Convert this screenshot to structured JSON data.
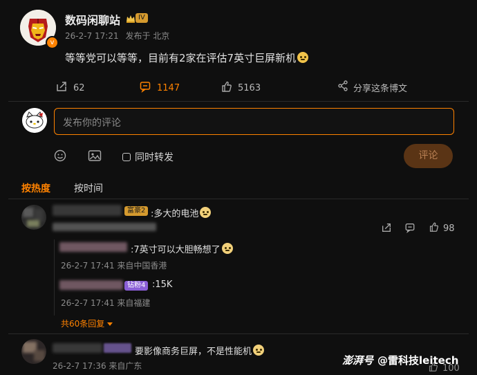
{
  "post": {
    "author_name": "数码闲聊站",
    "level_badge": "IV",
    "meta_time": "26-2-7 17:21",
    "meta_location": "发布于 北京",
    "content": "等等党可以等等，目前有2家在评估7英寸巨屏新机",
    "actions": {
      "repost_count": "62",
      "comment_count": "1147",
      "like_count": "5163",
      "share_label": "分享这条博文"
    }
  },
  "composer": {
    "placeholder": "发布你的评论",
    "also_repost_label": "同时转发",
    "submit_label": "评论"
  },
  "sort_tabs": {
    "hot": "按热度",
    "time": "按时间"
  },
  "comments": [
    {
      "badge": "富豪2",
      "text": ":多大的电池",
      "likes": "98",
      "replies": [
        {
          "text": ":7英寸可以大胆畅想了",
          "meta": "26-2-7 17:41 来自中国香港"
        },
        {
          "badge": "钻粉4",
          "text": ":15K",
          "meta": "26-2-7 17:41 来自福建"
        }
      ],
      "more_replies": "共60条回复"
    },
    {
      "text": "要影像商务巨屏，不是性能机",
      "meta": "26-2-7 17:36 来自广东",
      "likes_partial": "100"
    }
  ],
  "watermark": {
    "brand": "澎湃号",
    "author": "@雷科技leitech"
  },
  "colors": {
    "accent": "#ff8200",
    "background": "#0f0f0f",
    "text": "#d8d8d8",
    "muted": "#8b8b8b"
  },
  "icons": [
    "iron-man-avatar",
    "crown-icon",
    "verified-orange-badge",
    "repost-icon",
    "comment-icon",
    "like-icon",
    "share-icon",
    "hello-kitty-avatar",
    "emoji-icon",
    "image-icon",
    "checkbox-icon",
    "chevron-down-icon"
  ]
}
